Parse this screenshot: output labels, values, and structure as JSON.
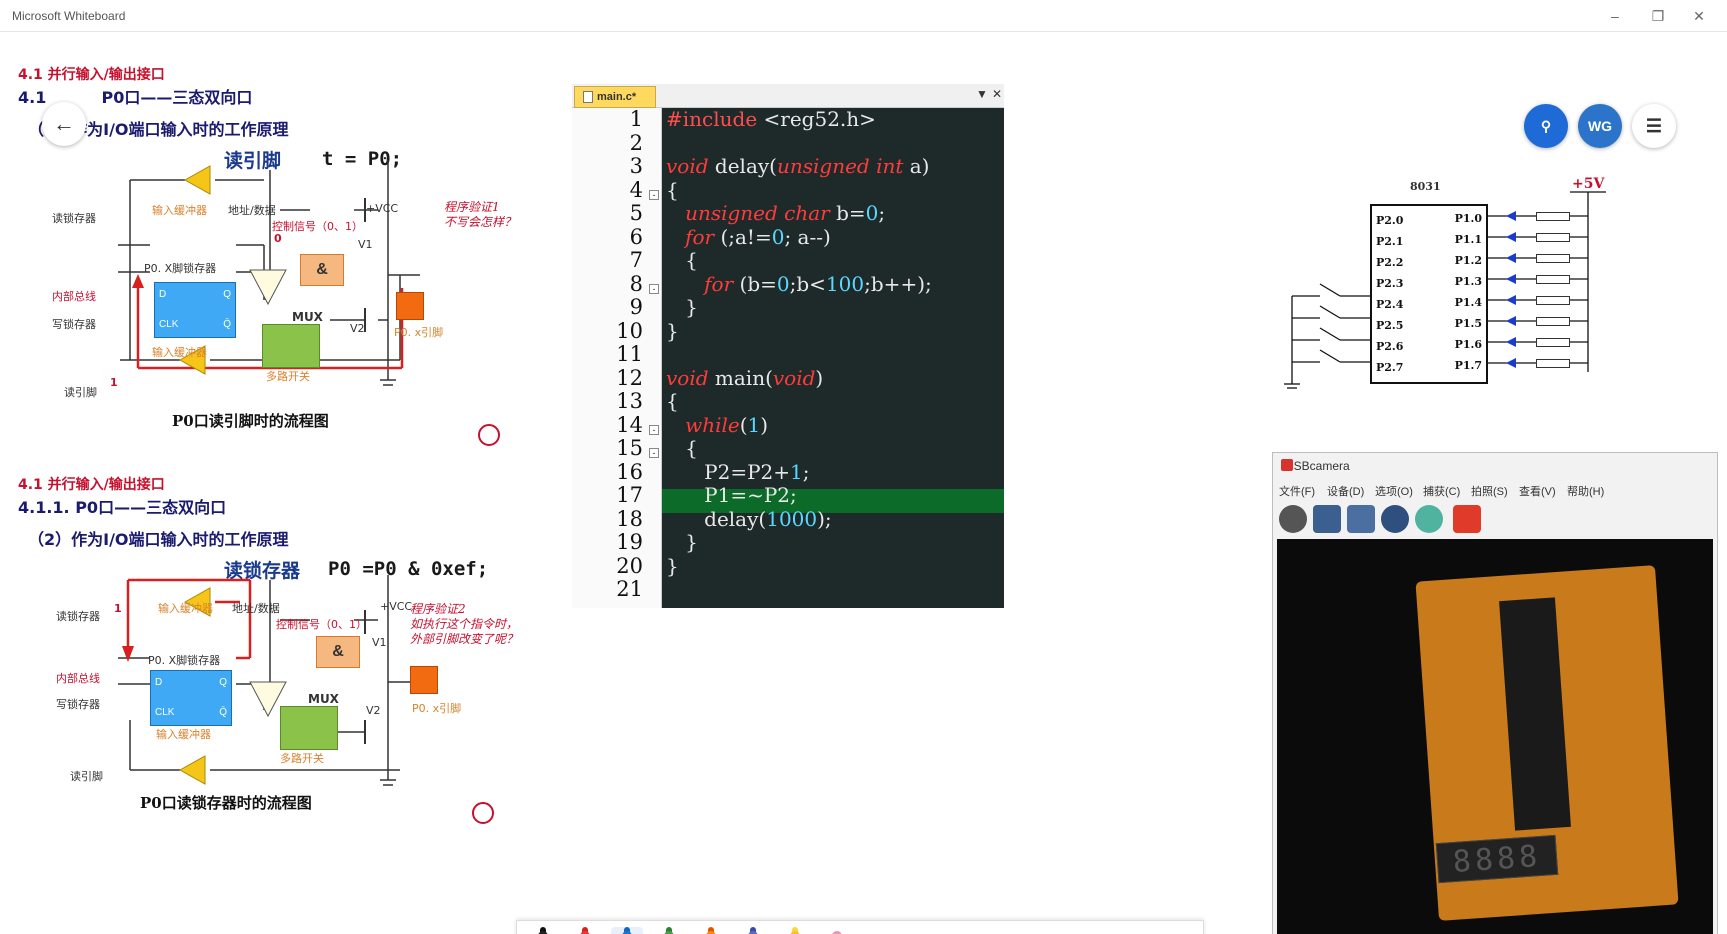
{
  "window": {
    "title": "Microsoft Whiteboard",
    "min": "–",
    "max": "❐",
    "close": "✕"
  },
  "slide1": {
    "section": "4.1 并行输入/输出接口",
    "heading_prefix": "4.1",
    "heading": "P0口——三态双向口",
    "sub": "（2）作为I/O端口输入时的工作原理",
    "code_label": "读引脚",
    "code_stmt": "t = P0;",
    "note": "程序验证1\n不写会怎样？",
    "caption": "P0口读引脚时的流程图",
    "labels": {
      "read_latch": "读锁存器",
      "input_buf_top": "输入缓冲器",
      "addr_data": "地址/数据",
      "vcc": "+VCC",
      "ctrl": "控制信号（0、1）",
      "zero": "0",
      "v1": "V1",
      "latch": "P0. X脚锁存器",
      "bus": "内部总线",
      "write_latch": "写锁存器",
      "d": "D",
      "q": "Q",
      "clk": "CLK",
      "qbar": "Q̄",
      "mux": "MUX",
      "v2": "V2",
      "pin": "P0. x引脚",
      "input_buf_bot": "输入缓冲器",
      "mux_sw": "多路开关",
      "read_pin": "读引脚",
      "one": "1",
      "and": "&"
    }
  },
  "slide2": {
    "section": "4.1 并行输入/输出接口",
    "heading": "4.1.1. P0口——三态双向口",
    "sub": "（2）作为I/O端口输入时的工作原理",
    "code_label": "读锁存器",
    "code_stmt": "P0 =P0 & 0xef;",
    "note": "程序验证2\n如执行这个指令时，\n外部引脚改变了呢？",
    "caption": "P0口读锁存器时的流程图",
    "labels": {
      "read_latch": "读锁存器",
      "one": "1",
      "input_buf_top": "输入缓冲器",
      "addr_data": "地址/数据",
      "vcc": "+VCC",
      "ctrl": "控制信号（0、1）",
      "v1": "V1",
      "latch": "P0. X脚锁存器",
      "bus": "内部总线",
      "write_latch": "写锁存器",
      "d": "D",
      "q": "Q",
      "clk": "CLK",
      "qbar": "Q̄",
      "mux": "MUX",
      "v2": "V2",
      "pin": "P0. x引脚",
      "input_buf_bot": "输入缓冲器",
      "mux_sw": "多路开关",
      "read_pin": "读引脚",
      "and": "&"
    }
  },
  "editor": {
    "tab": "main.c*",
    "lines": [
      "1",
      "2",
      "3",
      "4",
      "5",
      "6",
      "7",
      "8",
      "9",
      "10",
      "11",
      "12",
      "13",
      "14",
      "15",
      "16",
      "17",
      "18",
      "19",
      "20",
      "21"
    ]
  },
  "schematic": {
    "chip": "8031",
    "vcc": "+5V",
    "left_pins": [
      "P2.0",
      "P2.1",
      "P2.2",
      "P2.3",
      "P2.4",
      "P2.5",
      "P2.6",
      "P2.7"
    ],
    "right_pins": [
      "P1.0",
      "P1.1",
      "P1.2",
      "P1.3",
      "P1.4",
      "P1.5",
      "P1.6",
      "P1.7"
    ]
  },
  "user": {
    "initials": "WG"
  },
  "camera": {
    "title": "USBcamera",
    "menu": [
      "文件(F)",
      "设备(D)",
      "选项(O)",
      "捕获(C)",
      "拍照(S)",
      "查看(V)",
      "帮助(H)"
    ],
    "display": "8888"
  }
}
